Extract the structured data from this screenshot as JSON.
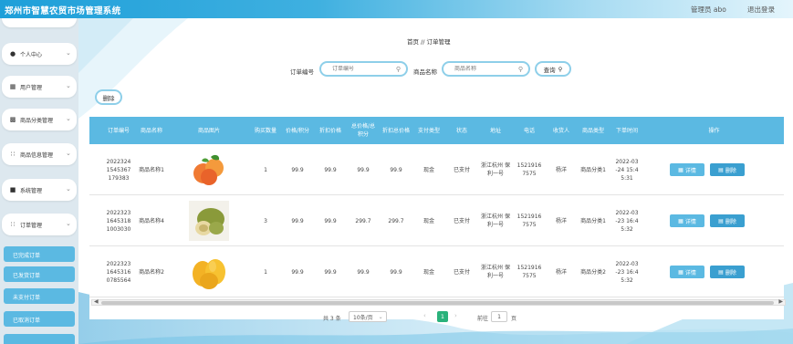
{
  "header": {
    "app_title": "郑州市智慧农贸市场管理系统",
    "user_role": "管理员 abo",
    "logout_label": "退出登录"
  },
  "sidebar": {
    "items": [
      {
        "label": "个人中心",
        "icon": "user-icon"
      },
      {
        "label": "用户管理",
        "icon": "list-icon"
      },
      {
        "label": "商品分类管理",
        "icon": "chart-icon"
      },
      {
        "label": "商品信息管理",
        "icon": "grid-icon"
      },
      {
        "label": "系统管理",
        "icon": "box-icon"
      },
      {
        "label": "订单管理",
        "icon": "grid-icon"
      }
    ],
    "sub_items": [
      "已完成订单",
      "已发货订单",
      "未支付订单",
      "已取消订单"
    ]
  },
  "breadcrumb": "首页 // 订单管理",
  "search": {
    "order_no_label": "订单编号",
    "order_no_placeholder": "订单编号",
    "product_name_label": "商品名称",
    "product_name_placeholder": "商品名称",
    "search_button": "查询"
  },
  "actions": {
    "delete_label": "删除"
  },
  "table": {
    "headers": [
      "订单编号",
      "商品名称",
      "商品图片",
      "购买数量",
      "价格/积分",
      "折扣价格",
      "总价格/总积分",
      "折扣总价格",
      "支付类型",
      "状态",
      "地址",
      "电话",
      "收货人",
      "商品类型",
      "下单时间",
      "操作"
    ],
    "rows": [
      {
        "order_no": "2022324 1545367 179383",
        "product": "商品名称1",
        "qty": "1",
        "price": "99.9",
        "discount": "99.9",
        "total": "99.9",
        "discount_total": "99.9",
        "pay_type": "现金",
        "status": "已支付",
        "address": "浙江杭州 保利一号",
        "phone": "1521916 7575",
        "receiver": "杨洋",
        "category": "商品分类1",
        "time": "2022-03 -24 15:4 5:31",
        "fruit": "orange"
      },
      {
        "order_no": "2022323 1645318 1003030",
        "product": "商品名称4",
        "qty": "3",
        "price": "99.9",
        "discount": "99.9",
        "total": "299.7",
        "discount_total": "299.7",
        "pay_type": "现金",
        "status": "已支付",
        "address": "浙江杭州 保利一号",
        "phone": "1521916 7575",
        "receiver": "杨洋",
        "category": "商品分类1",
        "time": "2022-03 -23 16:4 5:32",
        "fruit": "melon"
      },
      {
        "order_no": "2022323 1645316 0785564",
        "product": "商品名称2",
        "qty": "1",
        "price": "99.9",
        "discount": "99.9",
        "total": "99.9",
        "discount_total": "99.9",
        "pay_type": "现金",
        "status": "已支付",
        "address": "浙江杭州 保利一号",
        "phone": "1521916 7575",
        "receiver": "杨洋",
        "category": "商品分类2",
        "time": "2022-03 -23 16:4 5:32",
        "fruit": "mango"
      }
    ],
    "op_detail": "详情",
    "op_delete": "删除"
  },
  "pagination": {
    "total_text": "共 3 条",
    "page_size": "10条/页",
    "current_page": "1",
    "goto_label": "前往",
    "goto_value": "1",
    "page_suffix": "页"
  },
  "colors": {
    "accent": "#5bb9e2",
    "header_start": "#1e9fd9",
    "page_active": "#2ab27b"
  }
}
